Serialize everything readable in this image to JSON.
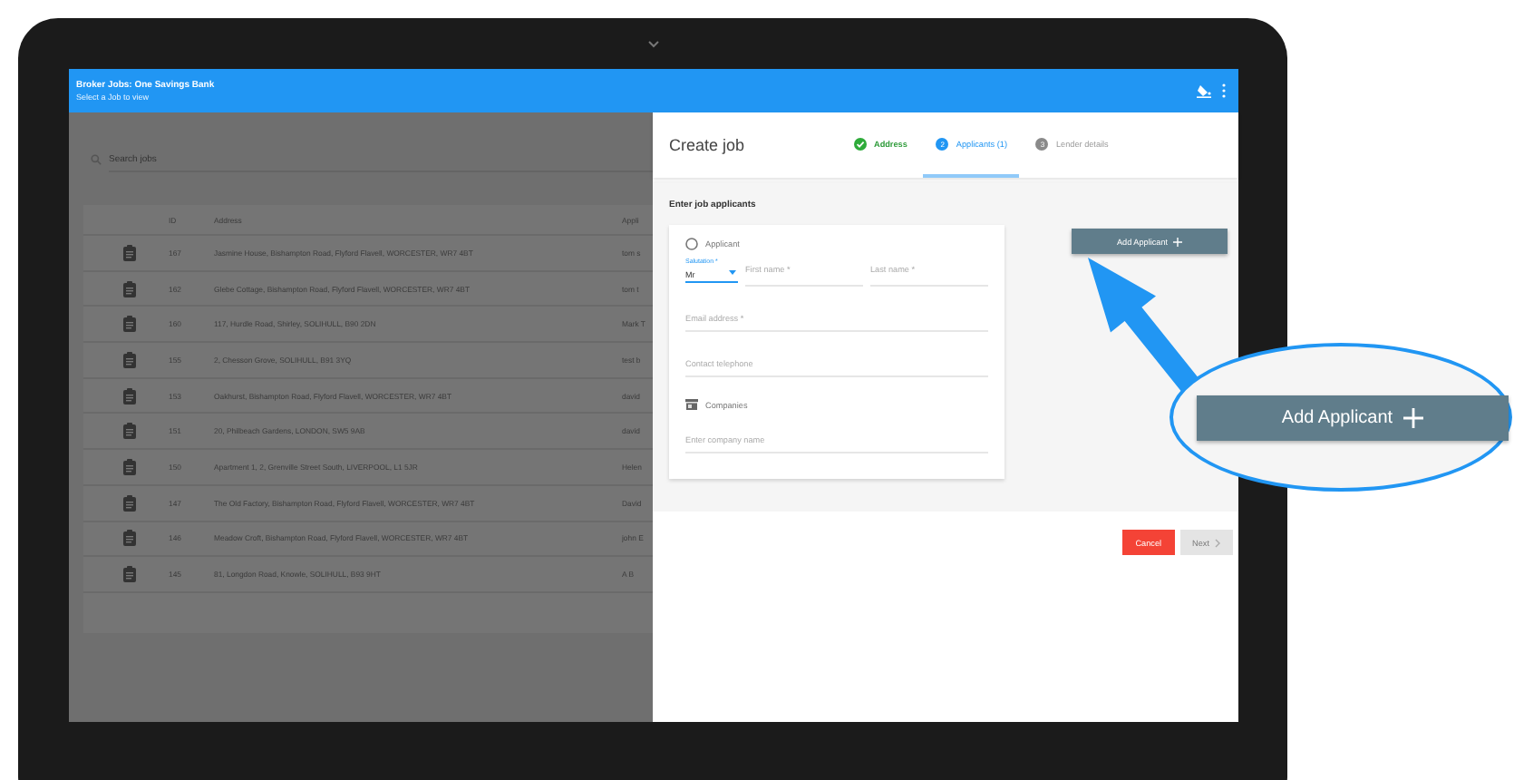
{
  "app_bar": {
    "title": "Broker Jobs: One Savings Bank",
    "subtitle": "Select a Job to view"
  },
  "search": {
    "placeholder": "Search jobs"
  },
  "jobs_table": {
    "columns": [
      "ID",
      "Address",
      "Appli"
    ],
    "rows": [
      {
        "id": "167",
        "address": "Jasmine House, Bishampton Road, Flyford Flavell, WORCESTER, WR7 4BT",
        "column_3": "tom s"
      },
      {
        "id": "162",
        "address": "Glebe Cottage, Bishampton Road, Flyford Flavell, WORCESTER, WR7 4BT",
        "column_3": "tom t"
      },
      {
        "id": "160",
        "address": "117, Hurdle Road, Shirley, SOLIHULL, B90 2DN",
        "column_3": "Mark T"
      },
      {
        "id": "155",
        "address": "2, Chesson Grove, SOLIHULL, B91 3YQ",
        "column_3": "test b"
      },
      {
        "id": "153",
        "address": "Oakhurst, Bishampton Road, Flyford Flavell, WORCESTER, WR7 4BT",
        "column_3": "david"
      },
      {
        "id": "151",
        "address": "20, Philbeach Gardens, LONDON, SW5 9AB",
        "column_3": "david"
      },
      {
        "id": "150",
        "address": "Apartment 1, 2, Grenville Street South, LIVERPOOL, L1 5JR",
        "column_3": "Helen"
      },
      {
        "id": "147",
        "address": "The Old Factory, Bishampton Road, Flyford Flavell, WORCESTER, WR7 4BT",
        "column_3": "David"
      },
      {
        "id": "146",
        "address": "Meadow Croft, Bishampton Road, Flyford Flavell, WORCESTER, WR7 4BT",
        "column_3": "john E"
      },
      {
        "id": "145",
        "address": "81, Longdon Road, Knowle, SOLIHULL, B93 9HT",
        "column_3": "A B"
      }
    ]
  },
  "drawer": {
    "title": "Create job",
    "steps": [
      {
        "label": "Address",
        "kind": "done",
        "selected": false
      },
      {
        "number": "2",
        "label": "Applicants (1)",
        "kind": "numbered",
        "selected": true
      },
      {
        "number": "3",
        "label": "Lender details",
        "kind": "numbered",
        "selected": false
      }
    ],
    "section_title": "Enter job applicants",
    "applicant_label": "Applicant",
    "salutation": {
      "label": "Salutation *",
      "value": "Mr"
    },
    "first_name": {
      "placeholder": "First name *"
    },
    "last_name": {
      "placeholder": "Last name *"
    },
    "email": {
      "placeholder": "Email address *"
    },
    "telephone": {
      "placeholder": "Contact telephone"
    },
    "companies_label": "Companies",
    "company": {
      "placeholder": "Enter company name"
    },
    "add_button": "Add Applicant",
    "cancel_button": {
      "label": "Cancel",
      "disabled": false
    },
    "next_button": {
      "label": "Next",
      "disabled": true
    }
  },
  "callout": {
    "button": "Add Applicant"
  }
}
